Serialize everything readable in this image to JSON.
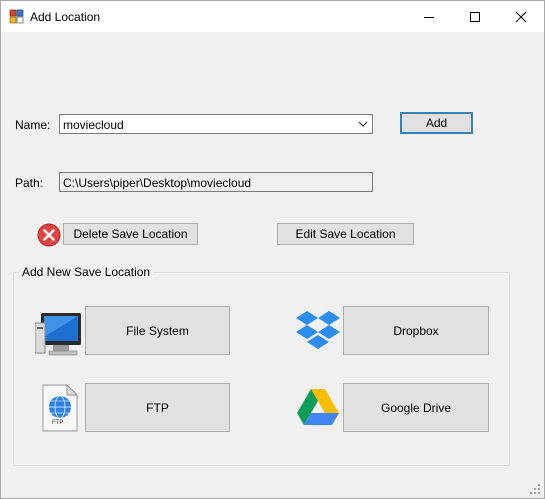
{
  "window": {
    "title": "Add Location"
  },
  "form": {
    "name_label": "Name:",
    "name_value": "moviecloud",
    "add_label": "Add",
    "path_label": "Path:",
    "path_value": "C:\\Users\\piper\\Desktop\\moviecloud",
    "delete_label": "Delete Save Location",
    "edit_label": "Edit Save Location"
  },
  "group": {
    "title": "Add New Save Location",
    "file_system": "File System",
    "dropbox": "Dropbox",
    "ftp": "FTP",
    "ftp_icon_caption": "FTP",
    "google_drive": "Google Drive"
  },
  "colors": {
    "accent": "#3c7fb1",
    "button_bg": "#e1e1e1",
    "window_bg": "#f0f0f0",
    "delete_red": "#e04343",
    "dropbox_blue": "#2d8cf0"
  }
}
